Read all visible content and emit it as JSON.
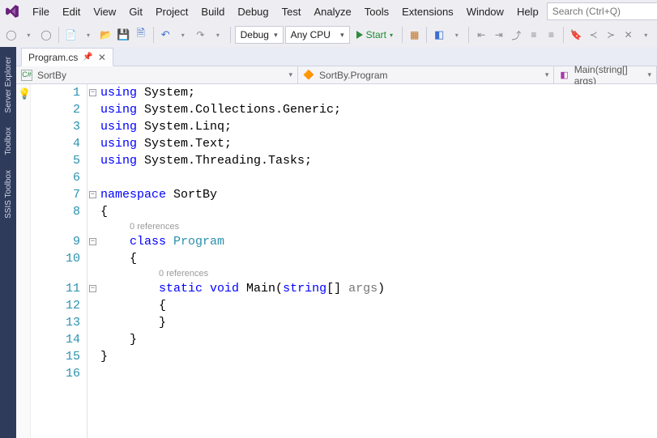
{
  "menu": {
    "items": [
      "File",
      "Edit",
      "View",
      "Git",
      "Project",
      "Build",
      "Debug",
      "Test",
      "Analyze",
      "Tools",
      "Extensions",
      "Window",
      "Help"
    ]
  },
  "search": {
    "placeholder": "Search (Ctrl+Q)"
  },
  "toolbar": {
    "config": "Debug",
    "platform": "Any CPU",
    "start": "Start"
  },
  "sidebar": {
    "tabs": [
      "Server Explorer",
      "Toolbox",
      "SSIS Toolbox"
    ]
  },
  "tabs": {
    "doc": "Program.cs"
  },
  "nav": {
    "scope": "SortBy",
    "type": "SortBy.Program",
    "member": "Main(string[] args)"
  },
  "code": {
    "references": "0 references",
    "lines": [
      {
        "n": 1,
        "tokens": [
          {
            "t": "using ",
            "c": "kw"
          },
          {
            "t": "System;",
            "c": "plain"
          }
        ]
      },
      {
        "n": 2,
        "tokens": [
          {
            "t": "using ",
            "c": "kw"
          },
          {
            "t": "System.Collections.Generic;",
            "c": "plain"
          }
        ]
      },
      {
        "n": 3,
        "tokens": [
          {
            "t": "using ",
            "c": "kw"
          },
          {
            "t": "System.Linq;",
            "c": "plain"
          }
        ]
      },
      {
        "n": 4,
        "tokens": [
          {
            "t": "using ",
            "c": "kw"
          },
          {
            "t": "System.Text;",
            "c": "plain"
          }
        ]
      },
      {
        "n": 5,
        "tokens": [
          {
            "t": "using ",
            "c": "kw"
          },
          {
            "t": "System.Threading.Tasks;",
            "c": "plain"
          }
        ]
      },
      {
        "n": 6,
        "tokens": [
          {
            "t": " ",
            "c": "plain"
          }
        ]
      },
      {
        "n": 7,
        "tokens": [
          {
            "t": "namespace ",
            "c": "kw"
          },
          {
            "t": "SortBy",
            "c": "plain"
          }
        ]
      },
      {
        "n": 8,
        "tokens": [
          {
            "t": "{",
            "c": "plain"
          }
        ]
      },
      {
        "n": 9,
        "ref": true,
        "tokens": [
          {
            "t": "    ",
            "c": "plain"
          },
          {
            "t": "class ",
            "c": "kw"
          },
          {
            "t": "Program",
            "c": "type"
          }
        ]
      },
      {
        "n": 10,
        "tokens": [
          {
            "t": "    {",
            "c": "plain"
          }
        ]
      },
      {
        "n": 11,
        "ref": true,
        "tokens": [
          {
            "t": "        ",
            "c": "plain"
          },
          {
            "t": "static ",
            "c": "kw"
          },
          {
            "t": "void ",
            "c": "kw"
          },
          {
            "t": "Main(",
            "c": "plain"
          },
          {
            "t": "string",
            "c": "kw"
          },
          {
            "t": "[] ",
            "c": "plain"
          },
          {
            "t": "args",
            "c": "paramg"
          },
          {
            "t": ")",
            "c": "plain"
          }
        ]
      },
      {
        "n": 12,
        "tokens": [
          {
            "t": "        {",
            "c": "plain"
          }
        ]
      },
      {
        "n": 13,
        "tokens": [
          {
            "t": "        }",
            "c": "plain"
          }
        ]
      },
      {
        "n": 14,
        "tokens": [
          {
            "t": "    }",
            "c": "plain"
          }
        ]
      },
      {
        "n": 15,
        "tokens": [
          {
            "t": "}",
            "c": "plain"
          }
        ]
      },
      {
        "n": 16,
        "tokens": [
          {
            "t": " ",
            "c": "plain"
          }
        ]
      }
    ]
  }
}
